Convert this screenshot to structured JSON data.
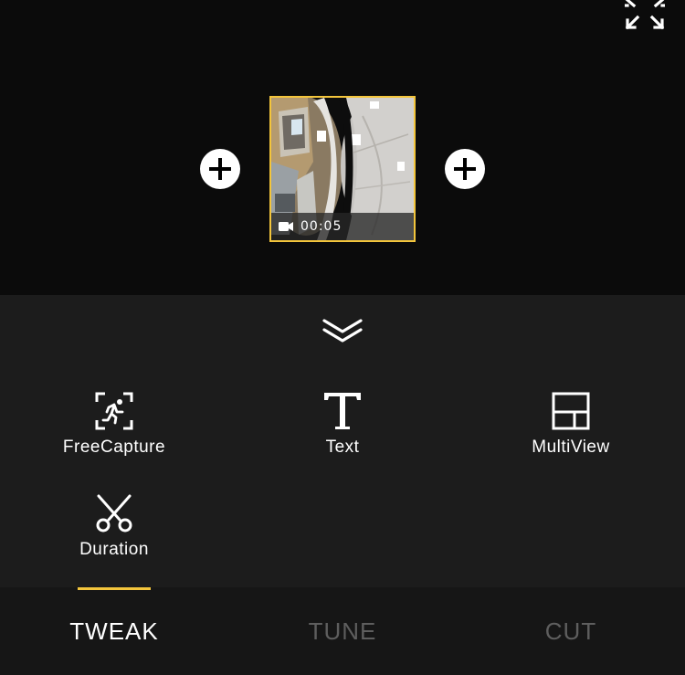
{
  "preview": {
    "clip": {
      "duration": "00:05",
      "selected": true,
      "icon": "video-camera-icon"
    },
    "add_left_icon": "plus-icon",
    "add_right_icon": "plus-icon",
    "fullscreen_icon": "expand-icon"
  },
  "panel": {
    "collapse_icon": "chevron-double-down-icon",
    "tools": [
      {
        "label": "FreeCapture",
        "icon": "free-capture-icon"
      },
      {
        "label": "Text",
        "icon": "text-icon"
      },
      {
        "label": "MultiView",
        "icon": "multiview-icon"
      },
      {
        "label": "Duration",
        "icon": "scissors-icon"
      }
    ]
  },
  "tabs": [
    {
      "label": "TWEAK",
      "active": true
    },
    {
      "label": "TUNE",
      "active": false
    },
    {
      "label": "CUT",
      "active": false
    }
  ],
  "colors": {
    "accent": "#f3c53c",
    "background": "#0b0b0b",
    "panel": "#1c1c1c",
    "tab_inactive": "#5e5e5e"
  }
}
